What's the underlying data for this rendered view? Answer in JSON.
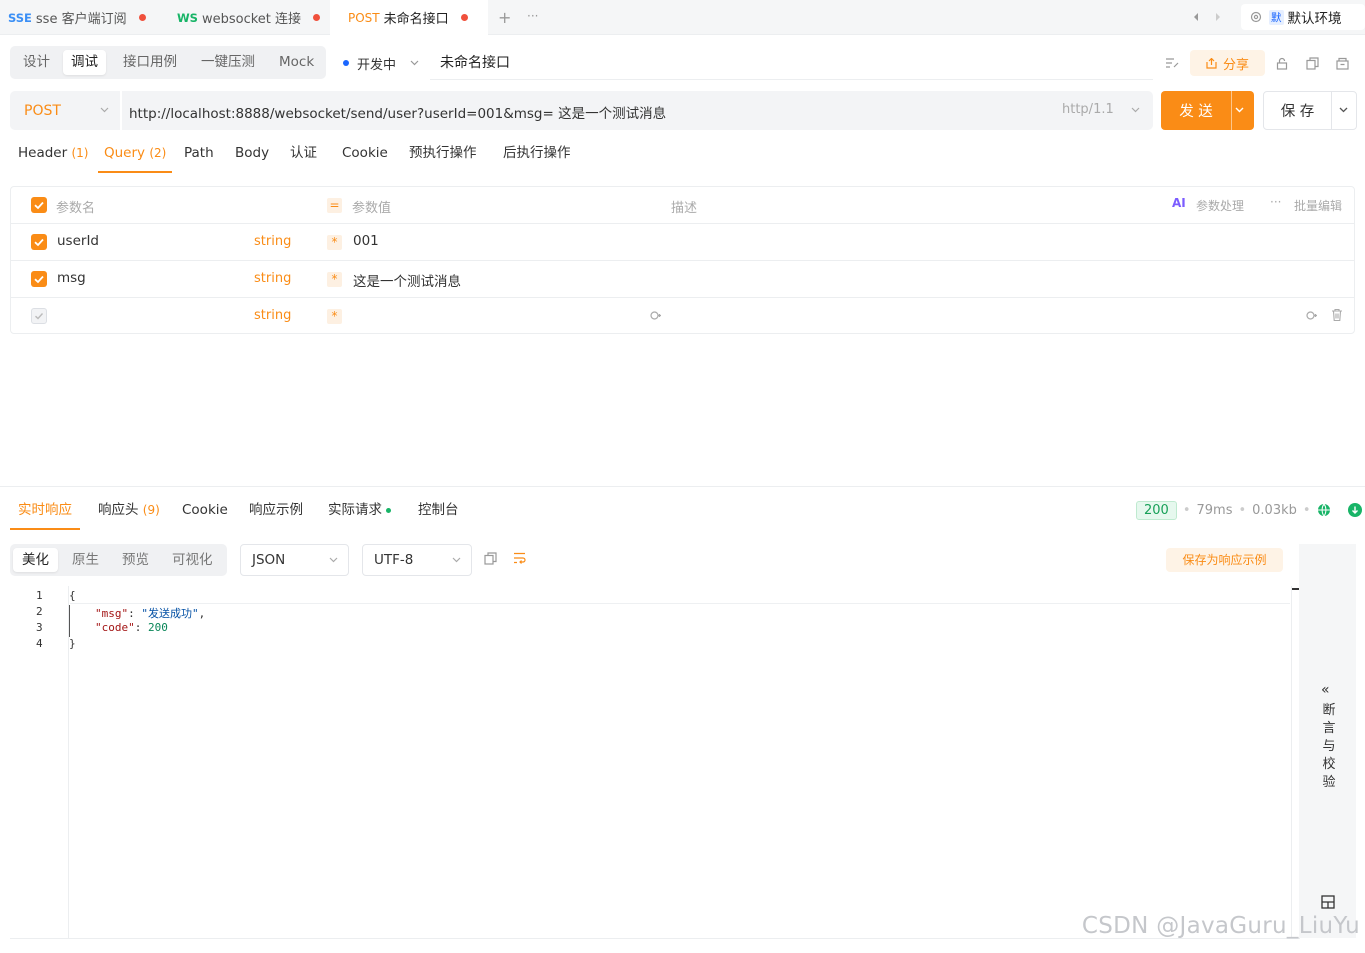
{
  "doc_tabs": [
    {
      "method": "SSE",
      "name": "sse 客户端订阅",
      "method_color": "#3b8ff5"
    },
    {
      "method": "WS",
      "name": "websocket 连接",
      "method_color": "#18b467"
    },
    {
      "method": "POST",
      "name": "未命名接口",
      "method_color": "#fa8c16"
    }
  ],
  "tabbar": {
    "add": "+",
    "more": "···",
    "env_badge": "默",
    "env_name": "默认环境"
  },
  "mode_tabs": [
    "设计",
    "调试",
    "接口用例",
    "一键压测",
    "Mock"
  ],
  "status": {
    "label": "开发中",
    "color": "#1a66ff"
  },
  "api_name": "未命名接口",
  "toolbar": {
    "share": "分享"
  },
  "request": {
    "method": "POST",
    "url": "http://localhost:8888/websocket/send/user?userId=001&msg= 这是一个测试消息",
    "protocol": "http/1.1",
    "send": "发 送",
    "save": "保 存"
  },
  "req_tabs": [
    {
      "label": "Header",
      "count": "(1)"
    },
    {
      "label": "Query",
      "count": "(2)"
    },
    {
      "label": "Path",
      "count": ""
    },
    {
      "label": "Body",
      "count": ""
    },
    {
      "label": "认证",
      "count": ""
    },
    {
      "label": "Cookie",
      "count": ""
    },
    {
      "label": "预执行操作",
      "count": ""
    },
    {
      "label": "后执行操作",
      "count": ""
    }
  ],
  "params": {
    "header": {
      "name": "参数名",
      "eq": "=",
      "value": "参数值",
      "desc": "描述",
      "ai": "AI",
      "process": "参数处理",
      "more": "···",
      "batch": "批量编辑"
    },
    "rows": [
      {
        "name": "userId",
        "type": "string",
        "value": "001",
        "checked": true
      },
      {
        "name": "msg",
        "type": "string",
        "value": "这是一个测试消息",
        "checked": true
      },
      {
        "name": "",
        "type": "string",
        "value": "",
        "checked": false
      }
    ],
    "required_mark": "*"
  },
  "res_tabs": [
    {
      "label": "实时响应",
      "count": ""
    },
    {
      "label": "响应头",
      "count": "(9)"
    },
    {
      "label": "Cookie",
      "count": ""
    },
    {
      "label": "响应示例",
      "count": ""
    },
    {
      "label": "实际请求",
      "count": ""
    },
    {
      "label": "控制台",
      "count": ""
    }
  ],
  "response_meta": {
    "status": "200",
    "time": "79ms",
    "size": "0.03kb"
  },
  "view_tabs": [
    "美化",
    "原生",
    "预览",
    "可视化"
  ],
  "format": "JSON",
  "encoding": "UTF-8",
  "save_example": "保存为响应示例",
  "code": {
    "line_numbers": [
      "1",
      "2",
      "3",
      "4"
    ],
    "open": "{",
    "close": "}",
    "msg_key": "\"msg\"",
    "msg_value": "\"发送成功\"",
    "code_key": "\"code\"",
    "code_value": "200",
    "colon": ": ",
    "comma": ","
  },
  "side_panel": {
    "chevron": "«",
    "label_chars": [
      "断",
      "言",
      "与",
      "校",
      "验"
    ]
  },
  "watermark": "CSDN @JavaGuru_LiuYu"
}
